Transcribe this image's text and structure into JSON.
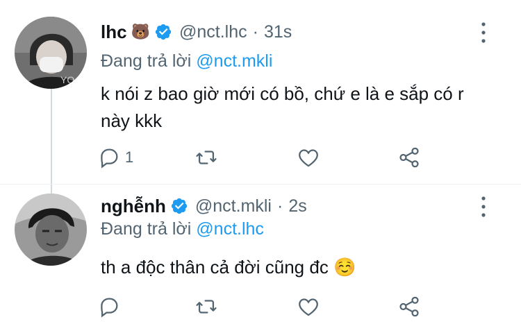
{
  "tweets": [
    {
      "name": "lhc",
      "name_emoji": "🐻",
      "handle": "@nct.lhc",
      "time": "31s",
      "replying_prefix": "Đang trả lời",
      "replying_to": "@nct.mkli",
      "text": "k nói z bao giờ mới có bồ, chứ e là e sắp có r này kkk",
      "reply_count": "1",
      "retweet_count": "",
      "like_count": ""
    },
    {
      "name": "nghễnh",
      "name_emoji": "",
      "handle": "@nct.mkli",
      "time": "2s",
      "replying_prefix": "Đang trả lời",
      "replying_to": "@nct.lhc",
      "text": "th a độc thân cả đời cũng đc ☺️",
      "reply_count": "",
      "retweet_count": "",
      "like_count": ""
    }
  ],
  "separator": "·",
  "icons": {
    "verified": "verified-badge-icon",
    "more": "more-vertical-icon",
    "reply": "reply-icon",
    "retweet": "retweet-icon",
    "like": "heart-icon",
    "share": "share-icon"
  },
  "colors": {
    "accent": "#1d9bf0",
    "secondary_text": "#536471",
    "icon": "#536471",
    "thread_line": "#cfd9de"
  }
}
